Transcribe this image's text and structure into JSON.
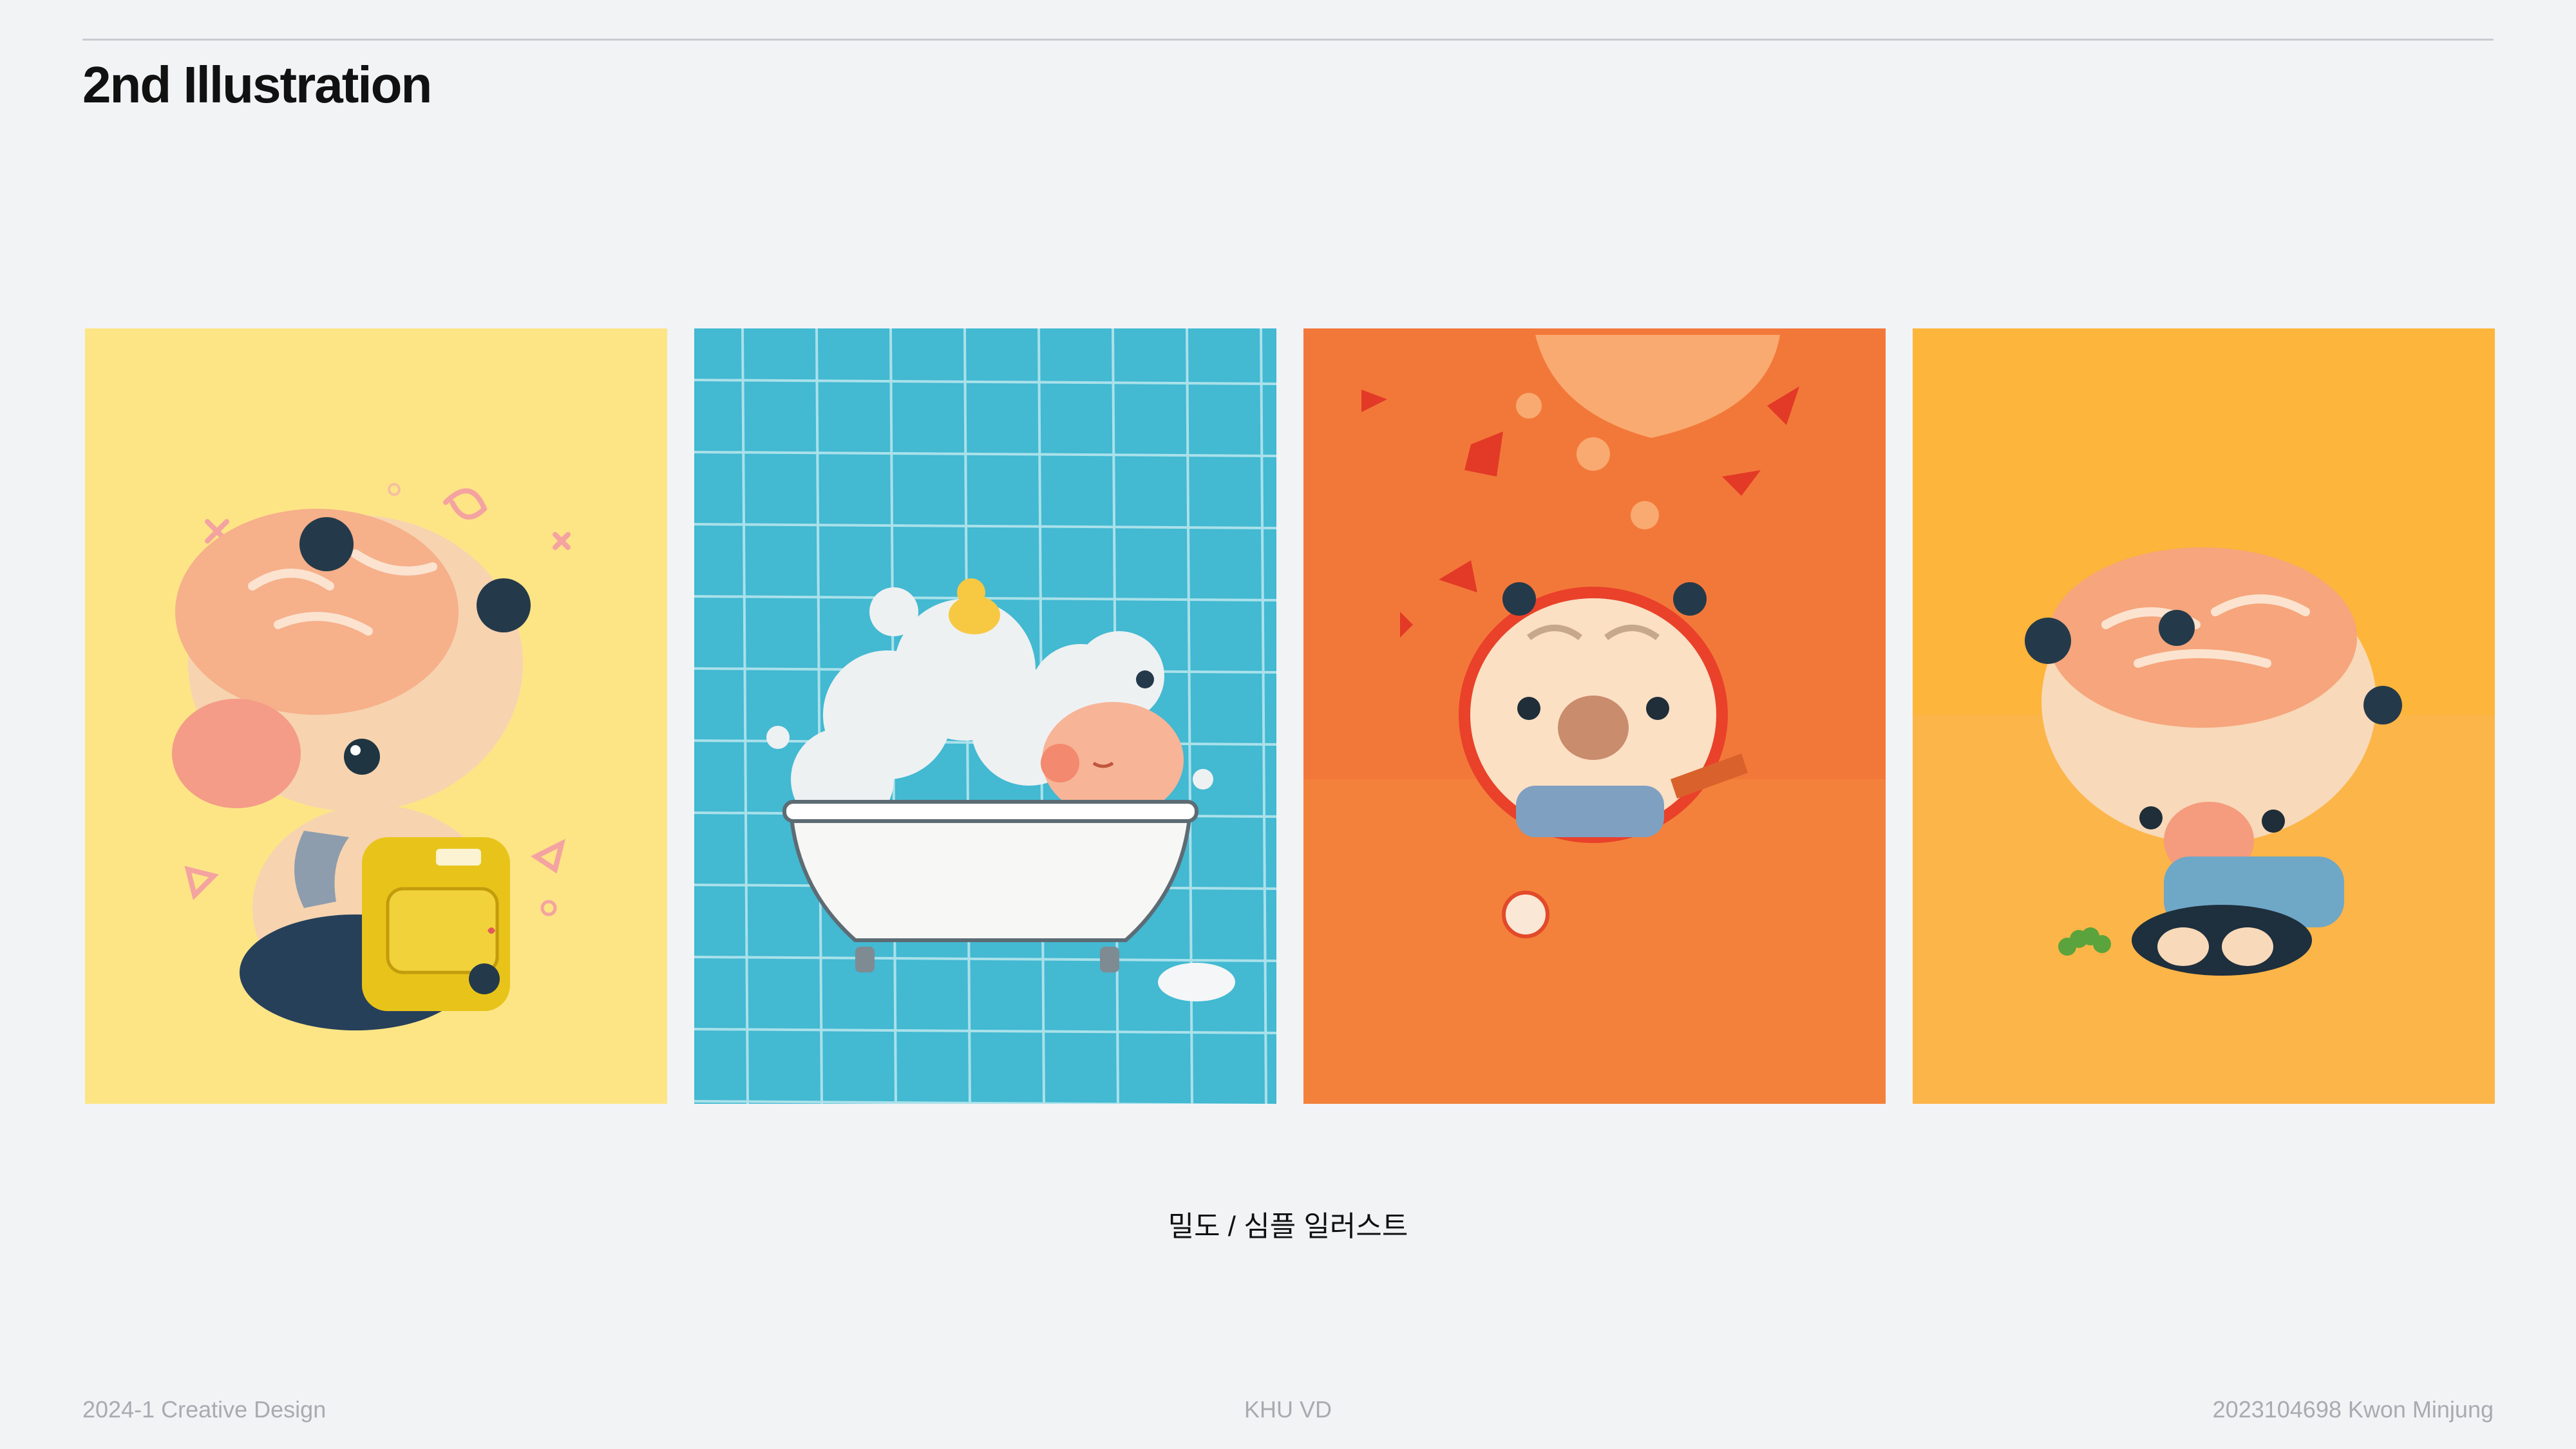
{
  "page": {
    "title": "2nd Illustration"
  },
  "illustrations": [
    {
      "name": "backpack",
      "background": "#fde586"
    },
    {
      "name": "bathtub",
      "background": "#43b9d2"
    },
    {
      "name": "baseball",
      "background": "#f2783a"
    },
    {
      "name": "sitting",
      "background": "#fdb53b"
    }
  ],
  "caption": "밀도 / 심플 일러스트",
  "footer": {
    "left": "2024-1 Creative Design",
    "center": "KHU VD",
    "right": "2023104698 Kwon Minjung"
  }
}
